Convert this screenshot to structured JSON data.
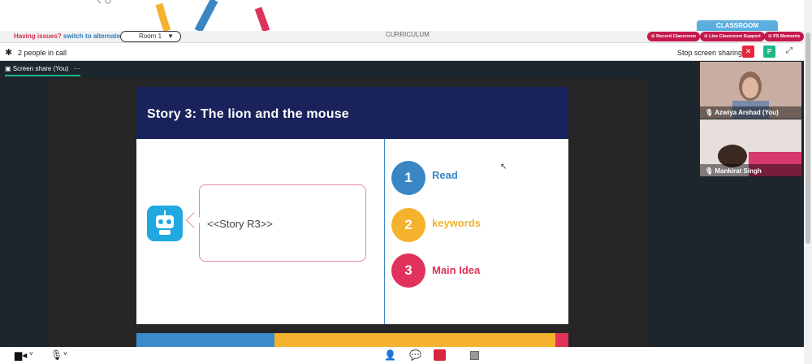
{
  "header": {
    "issues_text": "Having issues?",
    "alt_room_link": "switch to alternate room",
    "room_select": "Room 1",
    "curriculum": "CURRICULUM",
    "classroom_tab": "CLASSROOM",
    "record_btn": "Record Classroom",
    "support_btn": "Live Classroom Support",
    "moments_btn": "PS Moments"
  },
  "call": {
    "people_count": "2 people in call",
    "stop_share": "Stop screen sharing",
    "p_badge": "P",
    "share_tab": "Screen share (You)",
    "more": "···"
  },
  "slide": {
    "title": "Story 3:  The lion and the mouse",
    "bubble_text": "<<Story R3>>",
    "steps": [
      {
        "num": "1",
        "label": "Read",
        "color": "#3a86c4"
      },
      {
        "num": "2",
        "label": "keywords",
        "color": "#f4b22f"
      },
      {
        "num": "3",
        "label": "Main Idea",
        "color": "#e0325b"
      }
    ]
  },
  "participants": [
    {
      "name": "Azwiya Arshad (You)"
    },
    {
      "name": "Mankirat Singh"
    }
  ],
  "colors": {
    "accent_green": "#1db88a",
    "brand_red": "#c3194b",
    "slide_navy": "#19225a"
  }
}
